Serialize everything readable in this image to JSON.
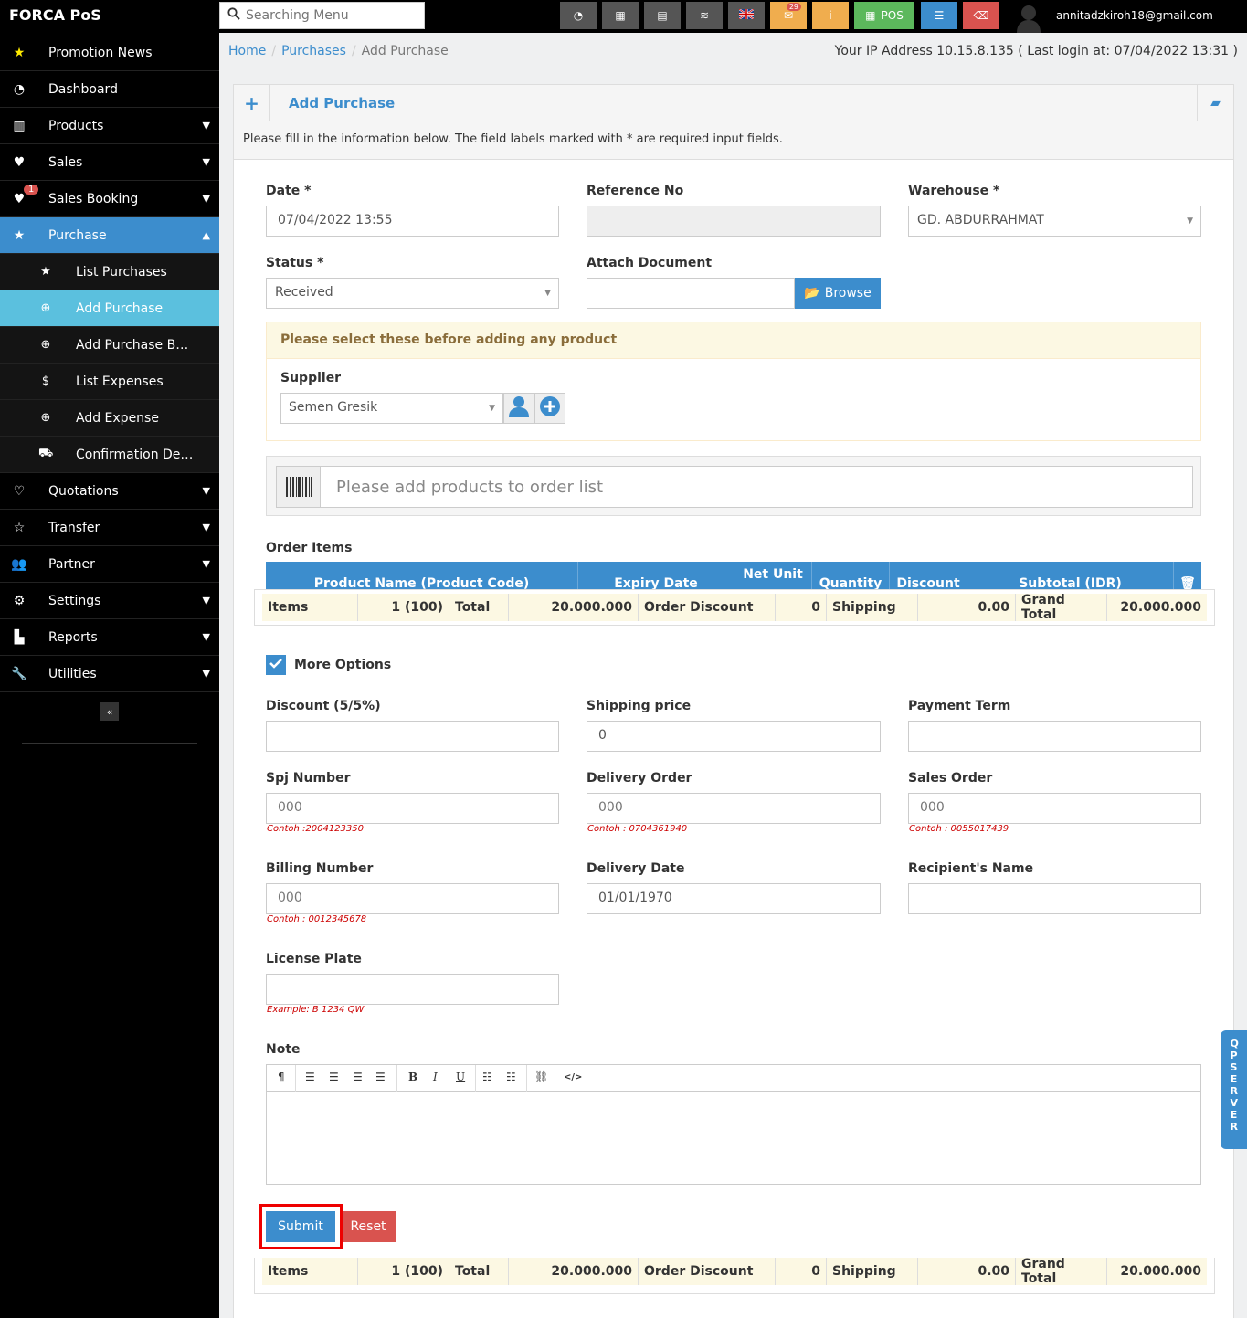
{
  "app": {
    "brand": "FORCA PoS"
  },
  "search": {
    "placeholder": "Searching Menu"
  },
  "toolbar": {
    "notifications_count": "29",
    "pos_label": "POS"
  },
  "user": {
    "email": "annitadzkiroh18@gmail.com"
  },
  "sidebar": {
    "items": [
      {
        "label": "Promotion News"
      },
      {
        "label": "Dashboard"
      },
      {
        "label": "Products"
      },
      {
        "label": "Sales"
      },
      {
        "label": "Sales Booking",
        "badge": "1"
      },
      {
        "label": "Purchase"
      },
      {
        "label": "Quotations"
      },
      {
        "label": "Transfer"
      },
      {
        "label": "Partner"
      },
      {
        "label": "Settings"
      },
      {
        "label": "Reports"
      },
      {
        "label": "Utilities"
      }
    ],
    "purchase_sub": [
      {
        "label": "List Purchases"
      },
      {
        "label": "Add Purchase"
      },
      {
        "label": "Add Purchase By ..."
      },
      {
        "label": "List Expenses"
      },
      {
        "label": "Add Expense"
      },
      {
        "label": "Confirmation Deli..."
      }
    ],
    "collapse_label": "«"
  },
  "breadcrumb": {
    "home": "Home",
    "purchases": "Purchases",
    "current": "Add Purchase"
  },
  "ip_info": "Your IP Address 10.15.8.135 ( Last login at: 07/04/2022 13:31 )",
  "panel": {
    "title": "Add Purchase",
    "intro": "Please fill in the information below. The field labels marked with * are required input fields."
  },
  "form": {
    "date_label": "Date *",
    "date_value": "07/04/2022 13:55",
    "reference_label": "Reference No",
    "reference_value": "",
    "warehouse_label": "Warehouse *",
    "warehouse_value": "GD. ABDURRAHMAT",
    "status_label": "Status *",
    "status_value": "Received",
    "attach_label": "Attach Document",
    "browse_label": "Browse",
    "notice": "Please select these before adding any product",
    "supplier_label": "Supplier",
    "supplier_value": "Semen Gresik",
    "product_placeholder": "Please add products to order list",
    "order_items_label": "Order Items",
    "more_options_label": "More Options",
    "discount_label": "Discount (5/5%)",
    "discount_value": "",
    "shipping_label": "Shipping price",
    "shipping_value": "0",
    "payment_term_label": "Payment Term",
    "payment_term_value": "",
    "spj_label": "Spj Number",
    "spj_placeholder": "000",
    "spj_hint": "Contoh :2004123350",
    "do_label": "Delivery Order",
    "do_placeholder": "000",
    "do_hint": "Contoh : 0704361940",
    "so_label": "Sales Order",
    "so_placeholder": "000",
    "so_hint": "Contoh : 0055017439",
    "billing_label": "Billing Number",
    "billing_placeholder": "000",
    "billing_hint": "Contoh : 0012345678",
    "delivery_date_label": "Delivery Date",
    "delivery_date_value": "01/01/1970",
    "recipient_label": "Recipient's Name",
    "recipient_value": "",
    "plate_label": "License Plate",
    "plate_value": "",
    "plate_hint": "Example: B 1234 QW",
    "note_label": "Note",
    "submit_label": "Submit",
    "reset_label": "Reset"
  },
  "order_table": {
    "headers": [
      "Product Name (Product Code)",
      "Expiry Date",
      "Net Unit",
      "Quantity",
      "Discount",
      "Subtotal (IDR)"
    ]
  },
  "totals": {
    "items_label": "Items",
    "items_value": "1 (100)",
    "total_label": "Total",
    "total_value": "20.000.000",
    "order_discount_label": "Order Discount",
    "order_discount_value": "0",
    "shipping_label": "Shipping",
    "shipping_value": "0.00",
    "grand_total_label": "Grand Total",
    "grand_total_value": "20.000.000"
  },
  "editor": {
    "buttons": [
      "¶",
      "B",
      "I",
      "U",
      "</>"
    ]
  },
  "side_tab": {
    "label": "QP SERVER"
  },
  "colors": {
    "accent": "#3c8dcd",
    "danger": "#d9534f",
    "info": "#5bc0de",
    "warning_bg": "#fcf8e3"
  }
}
